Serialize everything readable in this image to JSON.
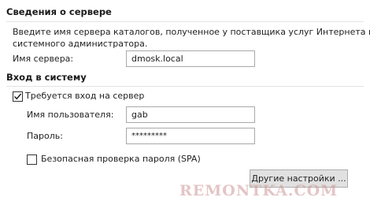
{
  "server_info": {
    "title": "Сведения о сервере",
    "description_line1": "Введите имя сервера каталогов, полученное у поставщика услуг Интернета или",
    "description_line2": "системного администратора.",
    "server_name_label": "Имя сервера:",
    "server_name_value": "dmosk.local"
  },
  "login": {
    "title": "Вход в систему",
    "requires_login_label": "Требуется вход на сервер",
    "requires_login_checked": true,
    "username_label": "Имя пользователя:",
    "username_value": "gab",
    "password_label": "Пароль:",
    "password_value": "*********",
    "spa_label": "Безопасная проверка пароля (SPA)",
    "spa_checked": false
  },
  "buttons": {
    "more_settings": "Другие настройки ..."
  },
  "watermark": "REMONTKA.COM"
}
